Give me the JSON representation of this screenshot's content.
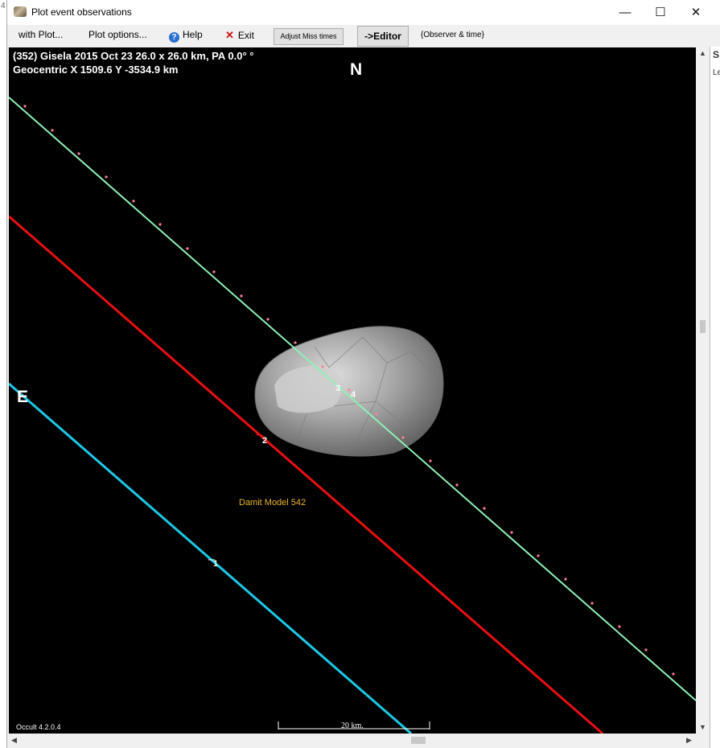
{
  "window": {
    "title": "Plot event observations",
    "controls": {
      "minimize": "—",
      "maximize": "☐",
      "close": "✕"
    }
  },
  "menu": {
    "with_plot": "with Plot...",
    "plot_options": "Plot options...",
    "help": "Help",
    "exit": "Exit",
    "adjust_miss": "Adjust Miss times",
    "editor": "->Editor",
    "observer_time": "{Observer & time}"
  },
  "plot": {
    "header_line1": "(352) Gisela  2015 Oct 23   26.0 x 26.0 km, PA 0.0° °",
    "header_line2": "Geocentric  X  1509.6  Y -3534.9 km",
    "north_label": "N",
    "east_label": "E",
    "model_label": "Damit Model 542",
    "version": "Occult 4.2.0.4",
    "scale_label": "20 km.",
    "chord_labels": [
      "1",
      "2",
      "3",
      "4"
    ],
    "colors": {
      "background": "#000000",
      "chord_1": "#1ec8e6",
      "chord_2": "#e81010",
      "chord_3_4": "#8ef0b4",
      "dots": "#ff7f9a",
      "asteroid": "#9a9a9a",
      "model_label": "#e8b42a"
    }
  },
  "right_panel": {
    "fragment_1": "S",
    "fragment_2": "Le"
  },
  "left_panel": {
    "fragment": "4"
  }
}
